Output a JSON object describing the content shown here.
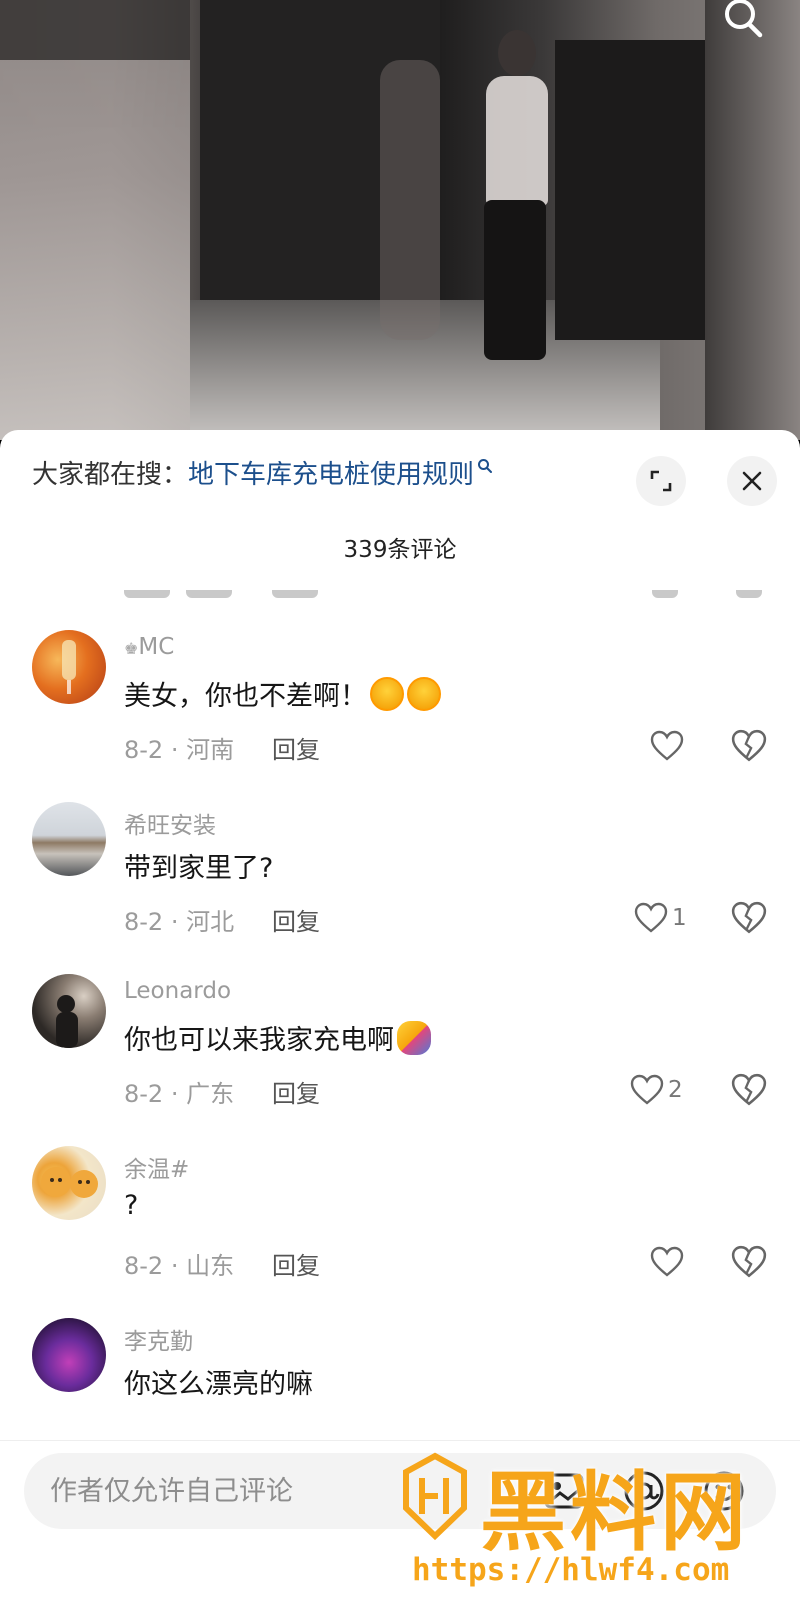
{
  "hot_search": {
    "prefix": "大家都在搜：",
    "term": "地下车库充电桩使用规则"
  },
  "comment_count": "339条评论",
  "comments": [
    {
      "username": "MC",
      "text": "美女，你也不差啊！",
      "emoji": [
        "crying-laughing-emoji",
        "crying-laughing-emoji"
      ],
      "date_location": "8-2 · 河南",
      "reply": "回复",
      "likes": ""
    },
    {
      "username": "希旺安装",
      "text": "带到家里了?",
      "emoji": [],
      "date_location": "8-2 · 河北",
      "reply": "回复",
      "likes": "1"
    },
    {
      "username": "Leonardo",
      "text": "你也可以来我家充电啊",
      "emoji": [
        "hugging-emoji"
      ],
      "date_location": "8-2 · 广东",
      "reply": "回复",
      "likes": "2"
    },
    {
      "username": "余温#",
      "text": "?",
      "emoji": [],
      "date_location": "8-2 · 山东",
      "reply": "回复",
      "likes": ""
    },
    {
      "username": "李克勤",
      "text": "你这么漂亮的嘛",
      "emoji": [],
      "date_location": "",
      "reply": "",
      "likes": ""
    }
  ],
  "input": {
    "placeholder": "作者仅允许自己评论"
  },
  "watermark": {
    "title": "黑料网",
    "url": "https://hlwf4.com"
  },
  "colors": {
    "accent_link": "#1c4f8c",
    "watermark": "#f6a51a"
  }
}
